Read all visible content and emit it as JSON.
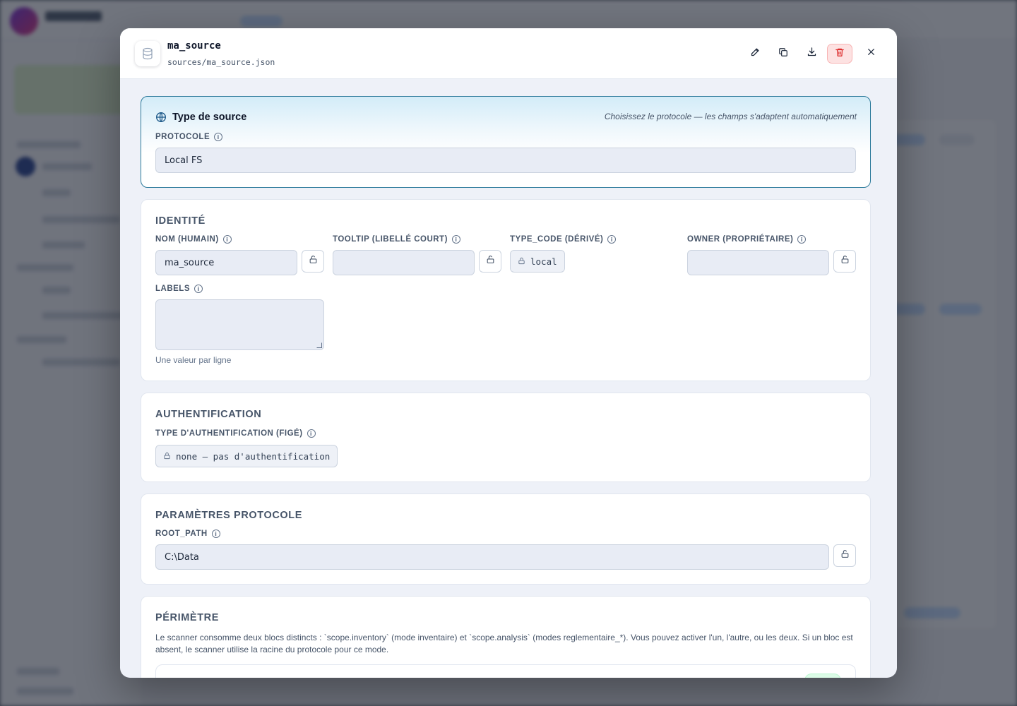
{
  "header": {
    "title": "ma_source",
    "path": "sources/ma_source.json",
    "actions": [
      "edit-icon",
      "copy-icon",
      "download-icon",
      "trash-icon",
      "close-icon"
    ]
  },
  "protocol_card": {
    "title": "Type de source",
    "hint": "Choisissez le protocole — les champs s'adaptent automatiquement",
    "protocol_label": "PROTOCOLE",
    "protocol_value": "Local FS"
  },
  "identity": {
    "title": "IDENTITÉ",
    "nom_label": "NOM (HUMAIN)",
    "nom_value": "ma_source",
    "tooltip_label": "TOOLTIP (LIBELLÉ COURT)",
    "tooltip_value": "",
    "type_code_label": "TYPE_CODE (DÉRIVÉ)",
    "type_code_value": "local",
    "owner_label": "OWNER (PROPRIÉTAIRE)",
    "owner_value": "",
    "labels_label": "LABELS",
    "labels_help": "Une valeur par ligne"
  },
  "auth": {
    "title": "AUTHENTIFICATION",
    "type_label": "TYPE D'AUTHENTIFICATION (FIGÉ)",
    "type_value": "none — pas d'authentification"
  },
  "params": {
    "title": "PARAMÈTRES PROTOCOLE",
    "root_label": "ROOT_PATH",
    "root_value": "C:\\Data"
  },
  "perimetre": {
    "title": "PÉRIMÈTRE",
    "description": "Le scanner consomme deux blocs distincts : `scope.inventory` (mode inventaire) et `scope.analysis` (modes reglementaire_*). Vous pouvez activer l'un, l'autre, ou les deux. Si un bloc est absent, le scanner utilise la racine du protocole pour ce mode."
  },
  "colors": {
    "accent": "#2c7a9b",
    "danger_bg": "#fde2e2",
    "danger_icon": "#dc2626",
    "input_bg": "#e8ecf5"
  }
}
